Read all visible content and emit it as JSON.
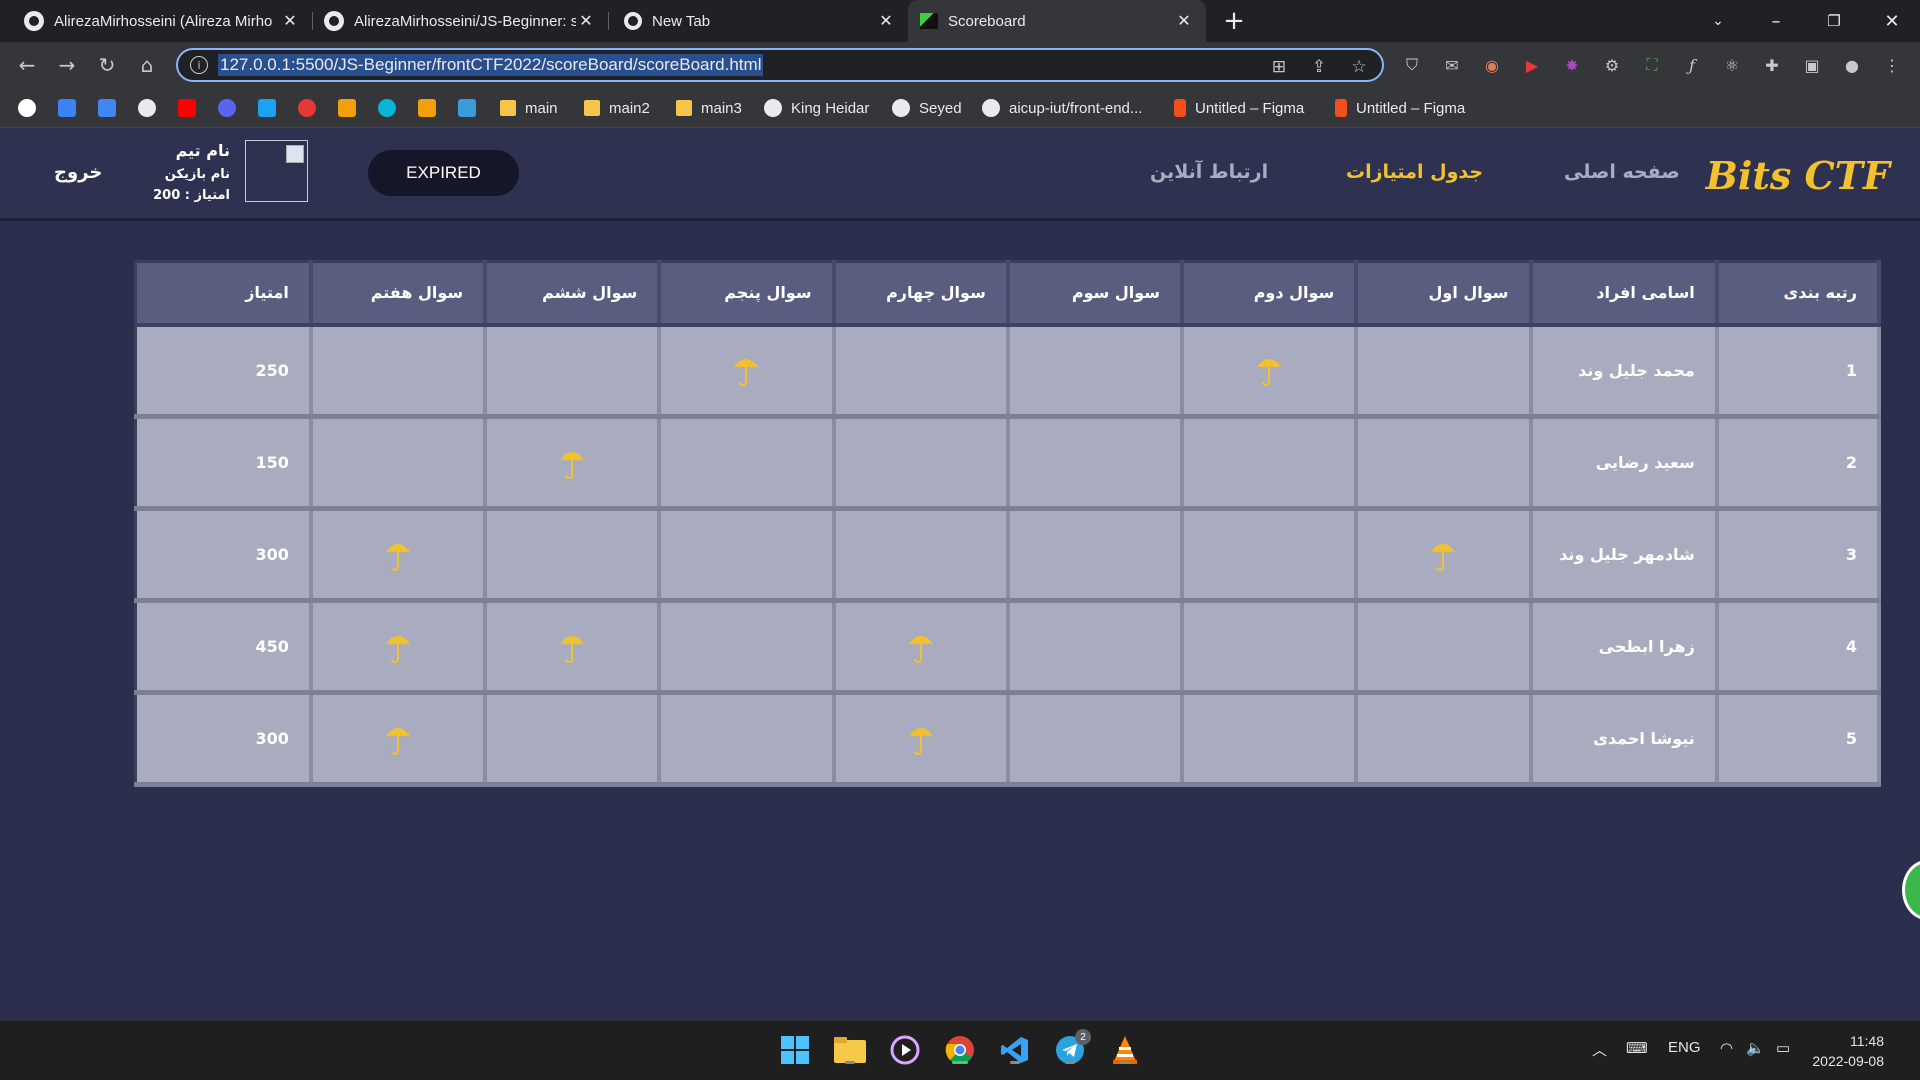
{
  "browser": {
    "tabs": [
      {
        "title": "AlirezaMirhosseini (Alireza Mirho",
        "icon": "github-icon"
      },
      {
        "title": "AlirezaMirhosseini/JS-Beginner: s",
        "icon": "github-icon"
      },
      {
        "title": "New Tab",
        "icon": "chrome-icon"
      },
      {
        "title": "Scoreboard",
        "icon": "flag-icon"
      }
    ],
    "close_glyph": "✕",
    "url": "127.0.0.1:5500/JS-Beginner/frontCTF2022/scoreBoard/scoreBoard.html",
    "bookmarks": [
      {
        "label": "main"
      },
      {
        "label": "main2"
      },
      {
        "label": "main3"
      },
      {
        "label": "King Heidar"
      },
      {
        "label": "Seyed"
      },
      {
        "label": "aicup-iut/front-end..."
      },
      {
        "label": "Untitled – Figma"
      },
      {
        "label": "Untitled – Figma"
      }
    ]
  },
  "site": {
    "logo": "Bits CTF",
    "nav": {
      "home": "صفحه اصلی",
      "scoreboard": "جدول امتیازات",
      "contact": "ارتباط آنلاین"
    },
    "status_button": "EXPIRED",
    "user": {
      "team": "نام تیم",
      "player": "نام بازیکن",
      "score": "امتیاز : 200"
    },
    "logout": "خروج",
    "accent_color": "#f2c12e"
  },
  "table": {
    "headers": [
      "رتبه بندی",
      "اسامی افراد",
      "سوال اول",
      "سوال دوم",
      "سوال سوم",
      "سوال چهارم",
      "سوال پنجم",
      "سوال ششم",
      "سوال هفتم",
      "امتیاز"
    ],
    "solved_icon": "umbrella-icon",
    "rows": [
      {
        "rank": "1",
        "name": "محمد جلیل وند",
        "solved": [
          false,
          true,
          false,
          false,
          true,
          false,
          false
        ],
        "score": "250"
      },
      {
        "rank": "2",
        "name": "سعید رضایی",
        "solved": [
          false,
          false,
          false,
          false,
          false,
          true,
          false
        ],
        "score": "150"
      },
      {
        "rank": "3",
        "name": "شادمهر جلیل وند",
        "solved": [
          true,
          false,
          false,
          false,
          false,
          false,
          true
        ],
        "score": "300"
      },
      {
        "rank": "4",
        "name": "زهرا ابطحی",
        "solved": [
          false,
          false,
          false,
          true,
          false,
          true,
          true
        ],
        "score": "450"
      },
      {
        "rank": "5",
        "name": "نیوشا احمدی",
        "solved": [
          false,
          false,
          false,
          true,
          false,
          false,
          true
        ],
        "score": "300"
      }
    ]
  },
  "taskbar": {
    "language": "ENG",
    "time": "11:48",
    "date": "2022-09-08",
    "telegram_badge": "2"
  }
}
